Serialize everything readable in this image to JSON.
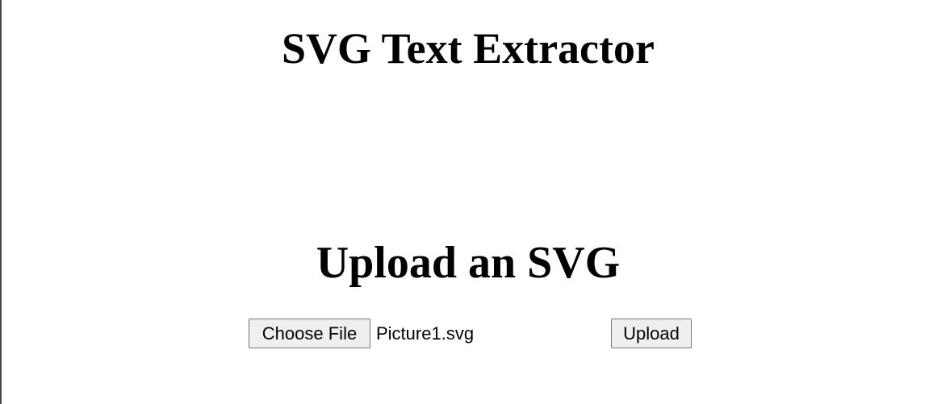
{
  "page": {
    "title": "SVG Text Extractor"
  },
  "upload": {
    "heading": "Upload an SVG",
    "choose_file_label": "Choose File",
    "selected_file": "Picture1.svg",
    "upload_label": "Upload"
  }
}
